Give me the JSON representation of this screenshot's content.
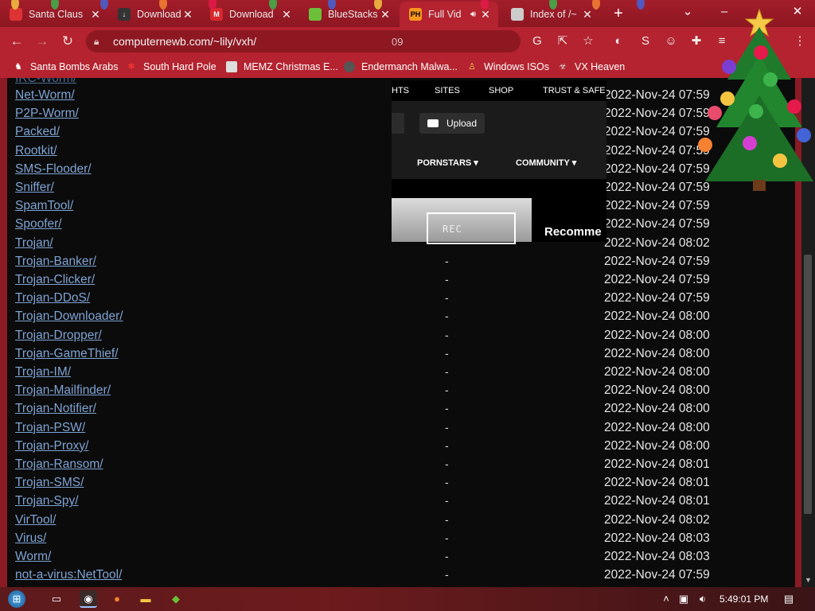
{
  "browser": {
    "tabs": [
      {
        "title": "Santa Claus",
        "favicon": "santa-icon"
      },
      {
        "title": "Downloads",
        "favicon": "download-icon"
      },
      {
        "title": "Download",
        "favicon": "mega-icon"
      },
      {
        "title": "BlueStacks",
        "favicon": "bluestacks-icon"
      },
      {
        "title": "Full Vid",
        "favicon": "ph-icon",
        "favicon_text": "PH",
        "active": true
      },
      {
        "title": "Index of /~",
        "favicon": "globe-icon"
      }
    ],
    "url": "computernewb.com/~lily/vxh/",
    "url_tail": "09",
    "bookmarks": [
      {
        "label": "Santa Bombs Arabs"
      },
      {
        "label": "South Hard Pole"
      },
      {
        "label": "MEMZ Christmas E..."
      },
      {
        "label": "Endermanch Malwa..."
      },
      {
        "label": "Windows ISOs"
      },
      {
        "label": "VX Heaven"
      }
    ]
  },
  "listing": {
    "rows": [
      {
        "name": "Net-Worm/",
        "size": "-",
        "date": "2022-Nov-24 07:59"
      },
      {
        "name": "P2P-Worm/",
        "size": "-",
        "date": "2022-Nov-24 07:59"
      },
      {
        "name": "Packed/",
        "size": "-",
        "date": "2022-Nov-24 07:59"
      },
      {
        "name": "Rootkit/",
        "size": "-",
        "date": "2022-Nov-24 07:59"
      },
      {
        "name": "SMS-Flooder/",
        "size": "-",
        "date": "2022-Nov-24 07:59"
      },
      {
        "name": "Sniffer/",
        "size": "-",
        "date": "2022-Nov-24 07:59"
      },
      {
        "name": "SpamTool/",
        "size": "-",
        "date": "2022-Nov-24 07:59"
      },
      {
        "name": "Spoofer/",
        "size": "-",
        "date": "2022-Nov-24 07:59"
      },
      {
        "name": "Trojan/",
        "size": "-",
        "date": "2022-Nov-24 08:02"
      },
      {
        "name": "Trojan-Banker/",
        "size": "-",
        "date": "2022-Nov-24 07:59"
      },
      {
        "name": "Trojan-Clicker/",
        "size": "-",
        "date": "2022-Nov-24 07:59"
      },
      {
        "name": "Trojan-DDoS/",
        "size": "-",
        "date": "2022-Nov-24 07:59"
      },
      {
        "name": "Trojan-Downloader/",
        "size": "-",
        "date": "2022-Nov-24 08:00"
      },
      {
        "name": "Trojan-Dropper/",
        "size": "-",
        "date": "2022-Nov-24 08:00"
      },
      {
        "name": "Trojan-GameThief/",
        "size": "-",
        "date": "2022-Nov-24 08:00"
      },
      {
        "name": "Trojan-IM/",
        "size": "-",
        "date": "2022-Nov-24 08:00"
      },
      {
        "name": "Trojan-Mailfinder/",
        "size": "-",
        "date": "2022-Nov-24 08:00"
      },
      {
        "name": "Trojan-Notifier/",
        "size": "-",
        "date": "2022-Nov-24 08:00"
      },
      {
        "name": "Trojan-PSW/",
        "size": "-",
        "date": "2022-Nov-24 08:00"
      },
      {
        "name": "Trojan-Proxy/",
        "size": "-",
        "date": "2022-Nov-24 08:00"
      },
      {
        "name": "Trojan-Ransom/",
        "size": "-",
        "date": "2022-Nov-24 08:01"
      },
      {
        "name": "Trojan-SMS/",
        "size": "-",
        "date": "2022-Nov-24 08:01"
      },
      {
        "name": "Trojan-Spy/",
        "size": "-",
        "date": "2022-Nov-24 08:01"
      },
      {
        "name": "VirTool/",
        "size": "-",
        "date": "2022-Nov-24 08:02"
      },
      {
        "name": "Virus/",
        "size": "-",
        "date": "2022-Nov-24 08:03"
      },
      {
        "name": "Worm/",
        "size": "-",
        "date": "2022-Nov-24 08:03"
      },
      {
        "name": "not-a-virus:NetTool/",
        "size": "-",
        "date": "2022-Nov-24 07:59"
      }
    ]
  },
  "overlay": {
    "nav": [
      "HTS",
      "SITES",
      "SHOP",
      "TRUST & SAFE"
    ],
    "upload_label": "Upload",
    "menus": [
      "PORNSTARS",
      "COMMUNITY"
    ],
    "thumb_text": "REC",
    "recommended": "Recomme"
  },
  "taskbar": {
    "clock": "5:49:01 PM"
  },
  "colors": {
    "chrome_theme": "#b4232f",
    "link": "#7fa4d4",
    "page_bg": "#0b0b0b"
  }
}
